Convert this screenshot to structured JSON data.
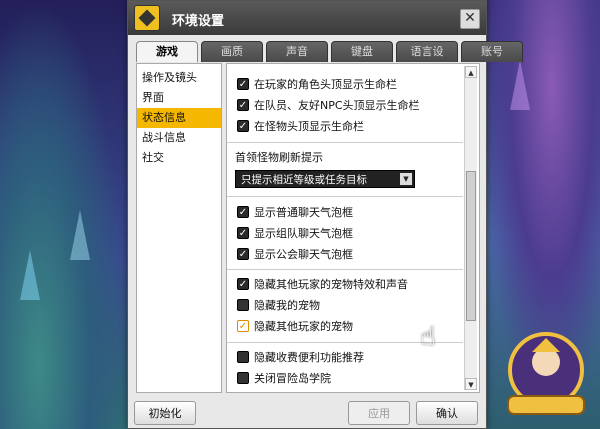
{
  "window": {
    "title": "环境设置",
    "close_label": "✕"
  },
  "tabs": [
    {
      "label": "游戏",
      "active": true
    },
    {
      "label": "画质"
    },
    {
      "label": "声音"
    },
    {
      "label": "键盘"
    },
    {
      "label": "语言设置"
    },
    {
      "label": "账号"
    }
  ],
  "sidebar": [
    {
      "label": "操作及镜头"
    },
    {
      "label": "界面"
    },
    {
      "label": "状态信息",
      "active": true
    },
    {
      "label": "战斗信息"
    },
    {
      "label": "社交"
    }
  ],
  "options": {
    "hp_group": [
      {
        "label": "在玩家的角色头顶显示生命栏",
        "checked": true
      },
      {
        "label": "在队员、友好NPC头顶显示生命栏",
        "checked": true
      },
      {
        "label": "在怪物头顶显示生命栏",
        "checked": true
      }
    ],
    "boss_refresh": {
      "label": "首领怪物刷新提示",
      "selected": "只提示相近等级或任务目标"
    },
    "chat_group": [
      {
        "label": "显示普通聊天气泡框",
        "checked": true
      },
      {
        "label": "显示组队聊天气泡框",
        "checked": true
      },
      {
        "label": "显示公会聊天气泡框",
        "checked": true
      }
    ],
    "pet_group": [
      {
        "label": "隐藏其他玩家的宠物特效和声音",
        "checked": true
      },
      {
        "label": "隐藏我的宠物",
        "checked": false
      },
      {
        "label": "隐藏其他玩家的宠物",
        "checked": true
      }
    ],
    "misc_group": [
      {
        "label": "隐藏收费便利功能推荐",
        "checked": false
      },
      {
        "label": "关闭冒险岛学院",
        "checked": false
      }
    ]
  },
  "footer": {
    "reset_label": "初始化",
    "apply_label": "应用",
    "confirm_label": "确认"
  },
  "scroll_position": 0.62
}
